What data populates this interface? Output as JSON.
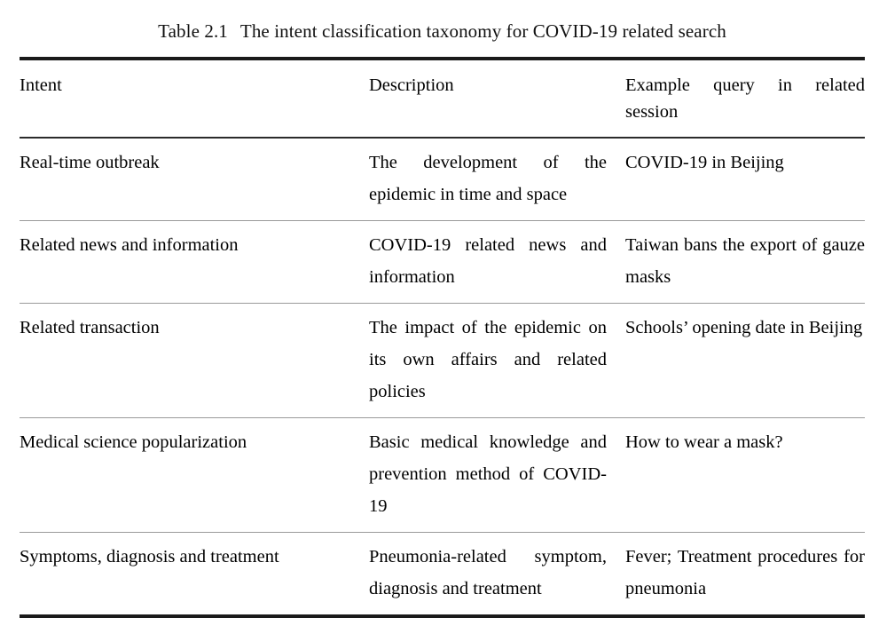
{
  "caption": {
    "number": "Table 2.1",
    "text": "The intent classification taxonomy for COVID-19 related search"
  },
  "table": {
    "headers": {
      "intent": "Intent",
      "description": "Description",
      "example": "Example query in related session"
    },
    "rows": [
      {
        "intent": "Real-time outbreak",
        "description": "The development of the epidemic in time and space",
        "example": "COVID-19 in Beijing"
      },
      {
        "intent": "Related news and information",
        "description": "COVID-19 related news and information",
        "example": "Taiwan bans the export of gauze masks"
      },
      {
        "intent": "Related transaction",
        "description": "The impact of the epi­demic on its own affairs and related policies",
        "example": "Schools’ opening date in Beijing"
      },
      {
        "intent": "Medical science popularization",
        "description": "Basic medical knowledge and prevention method of COVID-19",
        "example": "How to wear a mask?"
      },
      {
        "intent": "Symptoms, diagnosis and treatment",
        "description": "Pneumonia-related symp­tom, diagnosis and treat­ment",
        "example": "Fever; Treatment proce­dures for pneumonia"
      }
    ]
  },
  "colors": {
    "page_background": "#ffffff",
    "text": "#000000",
    "heavy_rule": "#1a1a1a",
    "header_rule": "#2b2b2b",
    "row_rule": "#9a9a9a"
  }
}
